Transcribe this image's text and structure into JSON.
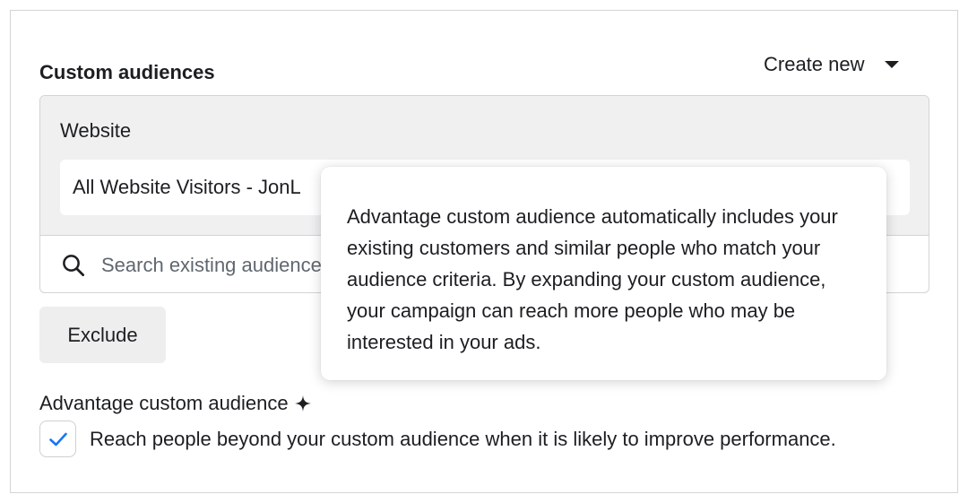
{
  "section": {
    "title": "Custom audiences",
    "create_new_label": "Create new"
  },
  "audience_group": {
    "label": "Website",
    "selected_audience": "All Website Visitors - JonL"
  },
  "search": {
    "placeholder": "Search existing audiences"
  },
  "exclude_label": "Exclude",
  "advantage": {
    "label": "Advantage custom audience",
    "checkbox_checked": true,
    "checkbox_label": "Reach people beyond your custom audience when it is likely to improve performance."
  },
  "tooltip": {
    "text": "Advantage custom audience automatically includes your existing customers and similar people who match your audience criteria. By expanding your custom audience, your campaign can reach more people who may be interested in your ads."
  },
  "colors": {
    "accent": "#1877f2",
    "group_bg": "#f0f0f1",
    "border": "#d3d4d6"
  },
  "icons": [
    "caret-down-icon",
    "search-icon",
    "sparkle-icon",
    "checkmark-icon"
  ]
}
